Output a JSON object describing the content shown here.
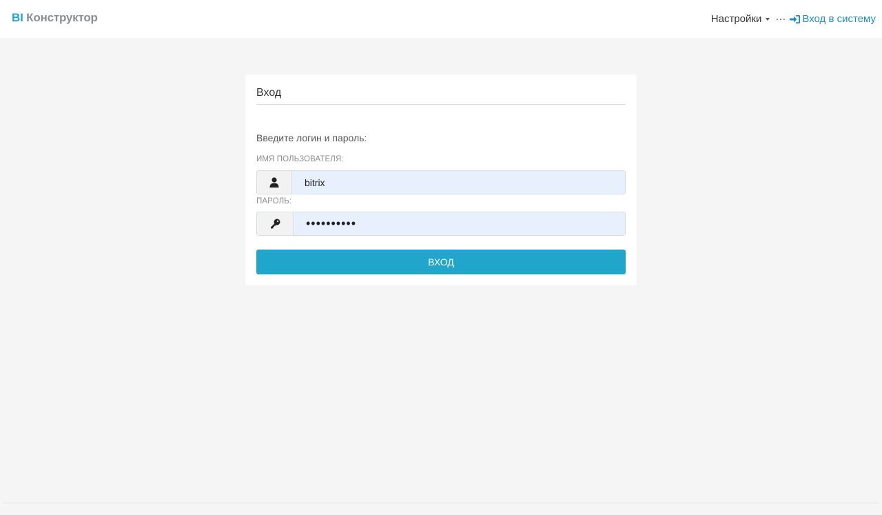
{
  "brand": {
    "prefix": "BI",
    "name": "Конструктор"
  },
  "nav": {
    "settings_label": "Настройки",
    "more_label": "···",
    "login_label": "Вход в систему"
  },
  "login": {
    "title": "Вход",
    "intro": "Введите логин и пароль:",
    "username_label": "Имя пользователя:",
    "username_value": "bitrix",
    "password_label": "Пароль:",
    "password_value": "••••••••••",
    "submit_label": "Вход"
  },
  "colors": {
    "accent": "#20a5cb",
    "brand_bi": "#1fa8ce",
    "link": "#1f8ec1",
    "autofill_bg": "#e8f0fe"
  },
  "icons": {
    "username": "user-icon",
    "password": "key-icon",
    "login": "sign-in-icon",
    "settings_caret": "caret-down-icon"
  }
}
